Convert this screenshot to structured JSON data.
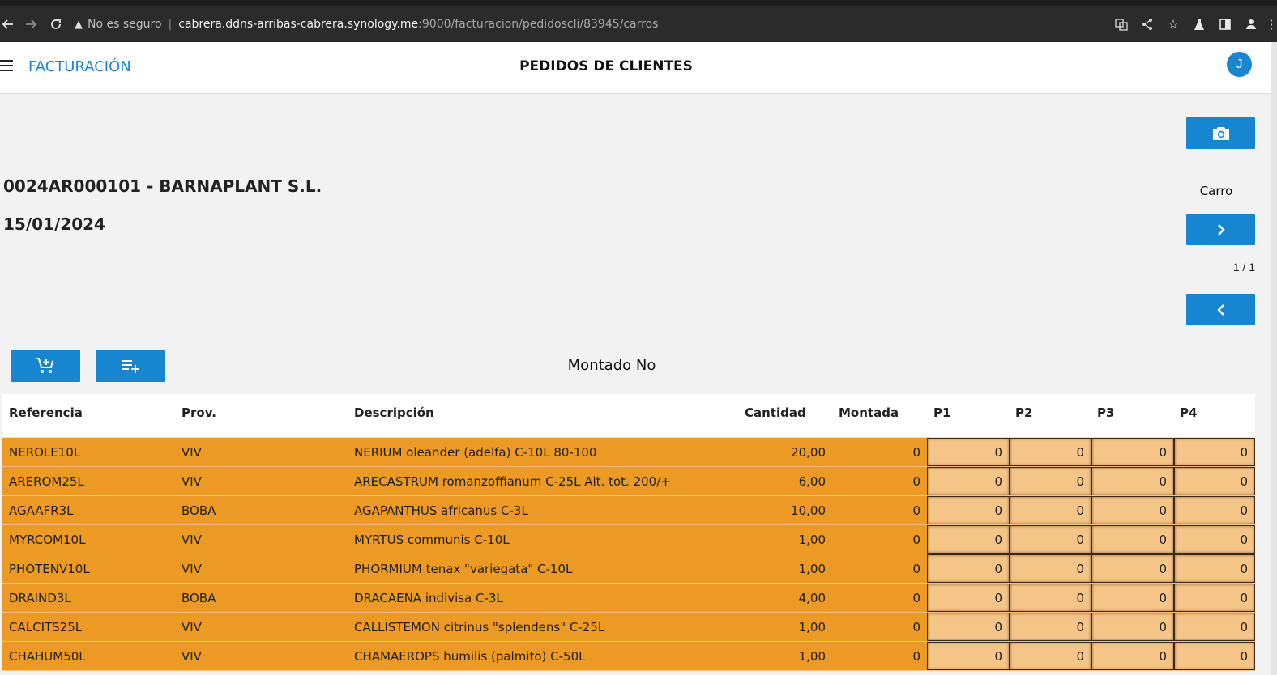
{
  "browser": {
    "security_text": "No es seguro",
    "url_host": "cabrera.ddns-arribas-cabrera.synology.me",
    "url_path": ":9000/facturacion/pedidoscli/83945/carros"
  },
  "header": {
    "app_title": "FACTURACIÓN",
    "page_title": "PEDIDOS DE CLIENTES",
    "avatar_initial": "J"
  },
  "order": {
    "code": "0024AR000101 - BARNAPLANT S.L.",
    "date": "15/01/2024"
  },
  "controls": {
    "carro_label": "Carro",
    "page_indicator": "1 / 1",
    "montado_label": "Montado No"
  },
  "icons": {
    "camera": "camera-icon",
    "next": "chevron-right-icon",
    "prev": "chevron-left-icon",
    "cart_add": "cart-add-icon",
    "list_add": "playlist-add-icon"
  },
  "colors": {
    "accent": "#1686d0",
    "row_bg": "#ec9a24",
    "pcell_bg": "#f5c487"
  },
  "table": {
    "headers": {
      "referencia": "Referencia",
      "prov": "Prov.",
      "descripcion": "Descripción",
      "cantidad": "Cantidad",
      "montada": "Montada",
      "p1": "P1",
      "p2": "P2",
      "p3": "P3",
      "p4": "P4"
    },
    "rows": [
      {
        "ref": "NEROLE10L",
        "prov": "VIV",
        "desc": "NERIUM oleander (adelfa) C-10L 80-100",
        "cant": "20,00",
        "montada": "0",
        "p1": "0",
        "p2": "0",
        "p3": "0",
        "p4": "0"
      },
      {
        "ref": "AREROM25L",
        "prov": "VIV",
        "desc": "ARECASTRUM romanzoffianum C-25L Alt. tot. 200/+",
        "cant": "6,00",
        "montada": "0",
        "p1": "0",
        "p2": "0",
        "p3": "0",
        "p4": "0"
      },
      {
        "ref": "AGAAFR3L",
        "prov": "BOBA",
        "desc": "AGAPANTHUS africanus C-3L",
        "cant": "10,00",
        "montada": "0",
        "p1": "0",
        "p2": "0",
        "p3": "0",
        "p4": "0"
      },
      {
        "ref": "MYRCOM10L",
        "prov": "VIV",
        "desc": "MYRTUS communis C-10L",
        "cant": "1,00",
        "montada": "0",
        "p1": "0",
        "p2": "0",
        "p3": "0",
        "p4": "0"
      },
      {
        "ref": "PHOTENV10L",
        "prov": "VIV",
        "desc": "PHORMIUM tenax \"variegata\" C-10L",
        "cant": "1,00",
        "montada": "0",
        "p1": "0",
        "p2": "0",
        "p3": "0",
        "p4": "0"
      },
      {
        "ref": "DRAIND3L",
        "prov": "BOBA",
        "desc": "DRACAENA indivisa C-3L",
        "cant": "4,00",
        "montada": "0",
        "p1": "0",
        "p2": "0",
        "p3": "0",
        "p4": "0"
      },
      {
        "ref": "CALCITS25L",
        "prov": "VIV",
        "desc": "CALLISTEMON citrinus \"splendens\" C-25L",
        "cant": "1,00",
        "montada": "0",
        "p1": "0",
        "p2": "0",
        "p3": "0",
        "p4": "0"
      },
      {
        "ref": "CHAHUM50L",
        "prov": "VIV",
        "desc": "CHAMAEROPS humilis (palmito) C-50L",
        "cant": "1,00",
        "montada": "0",
        "p1": "0",
        "p2": "0",
        "p3": "0",
        "p4": "0"
      }
    ]
  }
}
